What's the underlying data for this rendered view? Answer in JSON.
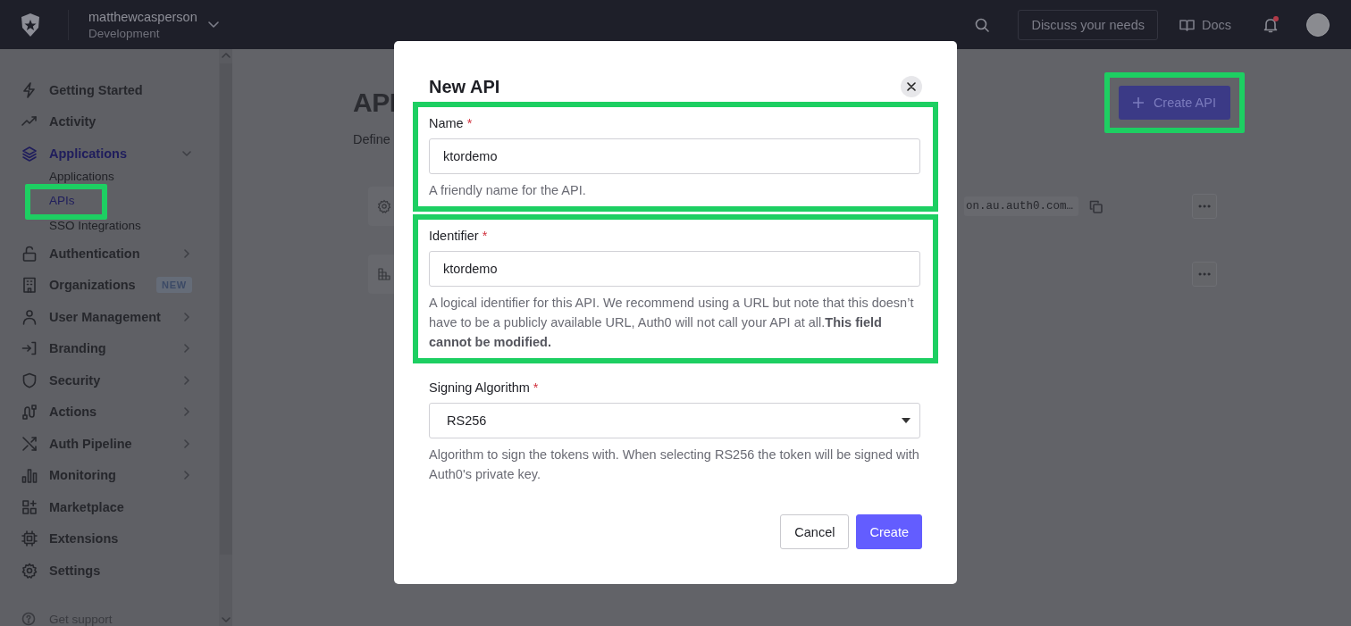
{
  "topbar": {
    "tenant": "matthewcasperson",
    "environment": "Development",
    "discuss_button": "Discuss your needs",
    "docs_link": "Docs",
    "has_notification": true
  },
  "sidebar": {
    "items": [
      {
        "label": "Getting Started",
        "kind": "link"
      },
      {
        "label": "Activity",
        "kind": "link"
      },
      {
        "label": "Applications",
        "kind": "group",
        "expanded": true,
        "selected": true,
        "children": [
          {
            "label": "Applications",
            "selected": false,
            "highlighted": false
          },
          {
            "label": "APIs",
            "selected": true,
            "highlighted": true
          },
          {
            "label": "SSO Integrations",
            "selected": false,
            "highlighted": false
          }
        ]
      },
      {
        "label": "Authentication",
        "kind": "group",
        "expanded": false,
        "selected": false
      },
      {
        "label": "Organizations",
        "kind": "badge",
        "badge": "NEW"
      },
      {
        "label": "User Management",
        "kind": "group",
        "expanded": false,
        "selected": false
      },
      {
        "label": "Branding",
        "kind": "group",
        "expanded": false,
        "selected": false
      },
      {
        "label": "Security",
        "kind": "group",
        "expanded": false,
        "selected": false
      },
      {
        "label": "Actions",
        "kind": "group",
        "expanded": false,
        "selected": false
      },
      {
        "label": "Auth Pipeline",
        "kind": "group",
        "expanded": false,
        "selected": false
      },
      {
        "label": "Monitoring",
        "kind": "group",
        "expanded": false,
        "selected": false
      },
      {
        "label": "Marketplace",
        "kind": "link"
      },
      {
        "label": "Extensions",
        "kind": "link"
      },
      {
        "label": "Settings",
        "kind": "link"
      }
    ],
    "footer": "Get support"
  },
  "page": {
    "title": "API",
    "description": "Define",
    "create_button": {
      "label": "Create API",
      "highlighted": true
    },
    "rows": [
      {
        "kind": "with-identifier",
        "identifier": "on.au.auth0.com…"
      },
      {
        "kind": "plain"
      }
    ]
  },
  "modal": {
    "title": "New API",
    "fields": [
      {
        "kind": "text",
        "label": "Name",
        "required_mark": "*",
        "value": "ktordemo",
        "help": "A friendly name for the API.",
        "highlighted": true
      },
      {
        "kind": "text",
        "label": "Identifier",
        "required_mark": "*",
        "value": "ktordemo",
        "help": "A logical identifier for this API. We recommend using a URL but note that this doesn’t have to be a publicly available URL, Auth0 will not call your API at all.**This field cannot be modified.**",
        "highlighted": true
      },
      {
        "kind": "select",
        "label": "Signing Algorithm",
        "required_mark": "*",
        "value": "RS256",
        "help": "Algorithm to sign the tokens with. When selecting RS256 the token will be signed with Auth0's private key.",
        "highlighted": false
      }
    ],
    "buttons": [
      {
        "label": "Cancel",
        "kind": "secondary"
      },
      {
        "label": "Create",
        "kind": "primary"
      }
    ]
  }
}
